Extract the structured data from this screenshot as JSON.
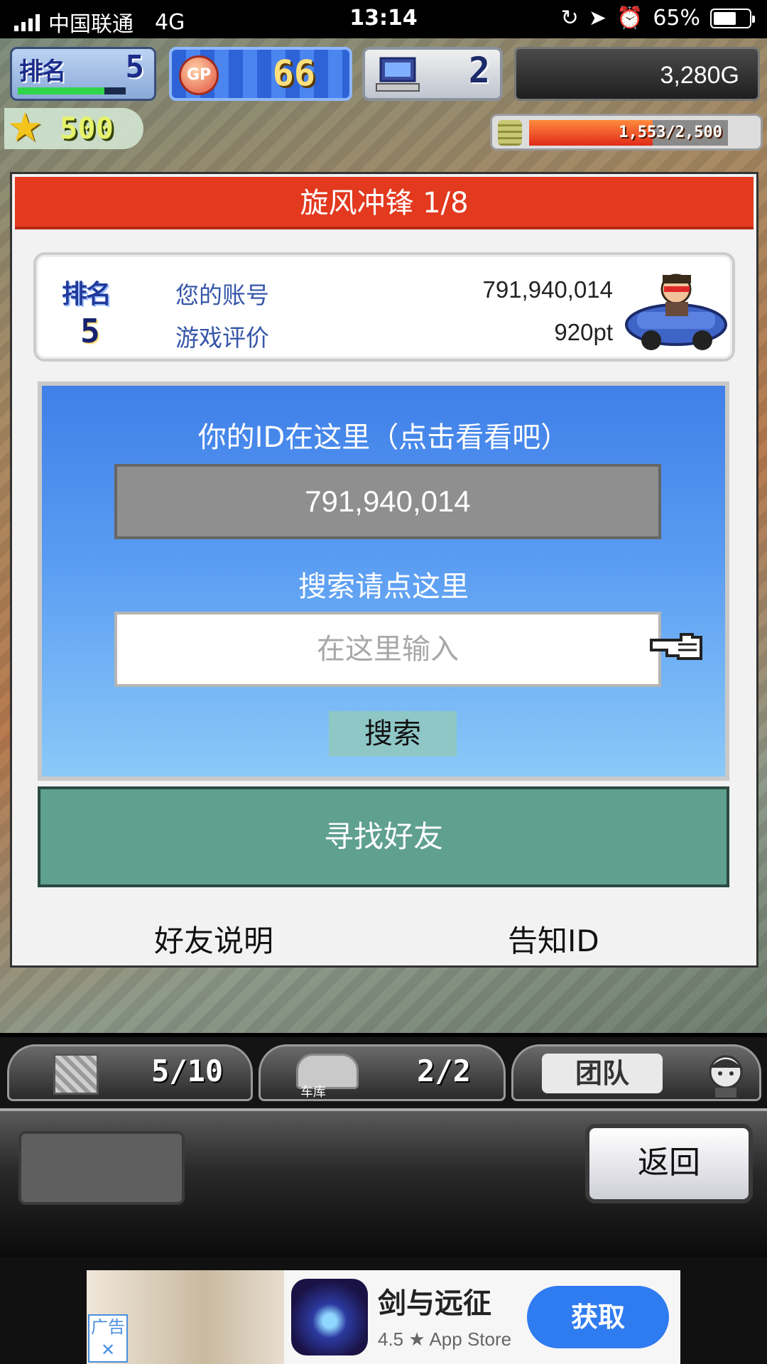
{
  "status_bar": {
    "carrier": "中国联通",
    "network": "4G",
    "time": "13:14",
    "battery_percent": "65%",
    "battery_level": 0.65,
    "icons": [
      "signal-icon",
      "rotation-lock-icon",
      "location-icon",
      "alarm-icon",
      "battery-icon"
    ]
  },
  "hud": {
    "rank_label": "排名",
    "rank_value": "5",
    "rank_progress": 0.8,
    "gp_label": "GP",
    "gp_value": "66",
    "pc_value": "2",
    "money": "3,280G",
    "star_value": "500",
    "fund_text": "1,553/2,500",
    "fund_progress": 0.621
  },
  "dialog": {
    "title": "旋风冲锋 1/8",
    "rank_label": "排名",
    "rank_value": "5",
    "account_label": "您的账号",
    "account_value": "791,940,014",
    "rating_label": "游戏评价",
    "rating_value": "920pt",
    "id_hint": "你的ID在这里（点击看看吧）",
    "id_value": "791,940,014",
    "search_hint": "搜索请点这里",
    "search_placeholder": "在这里输入",
    "search_button": "搜索",
    "find_friends_button": "寻找好友",
    "friend_help_link": "好友说明",
    "share_id_link": "告知ID"
  },
  "bottom_tabs": {
    "storage_count": "5/10",
    "garage_label": "车库",
    "garage_count": "2/2",
    "team_label": "团队"
  },
  "bottom_bar": {
    "back_button": "返回"
  },
  "ad": {
    "tag": "广告",
    "app_name": "剑与远征",
    "rating_line": "4.5 ★ App Store",
    "get_button": "获取"
  }
}
